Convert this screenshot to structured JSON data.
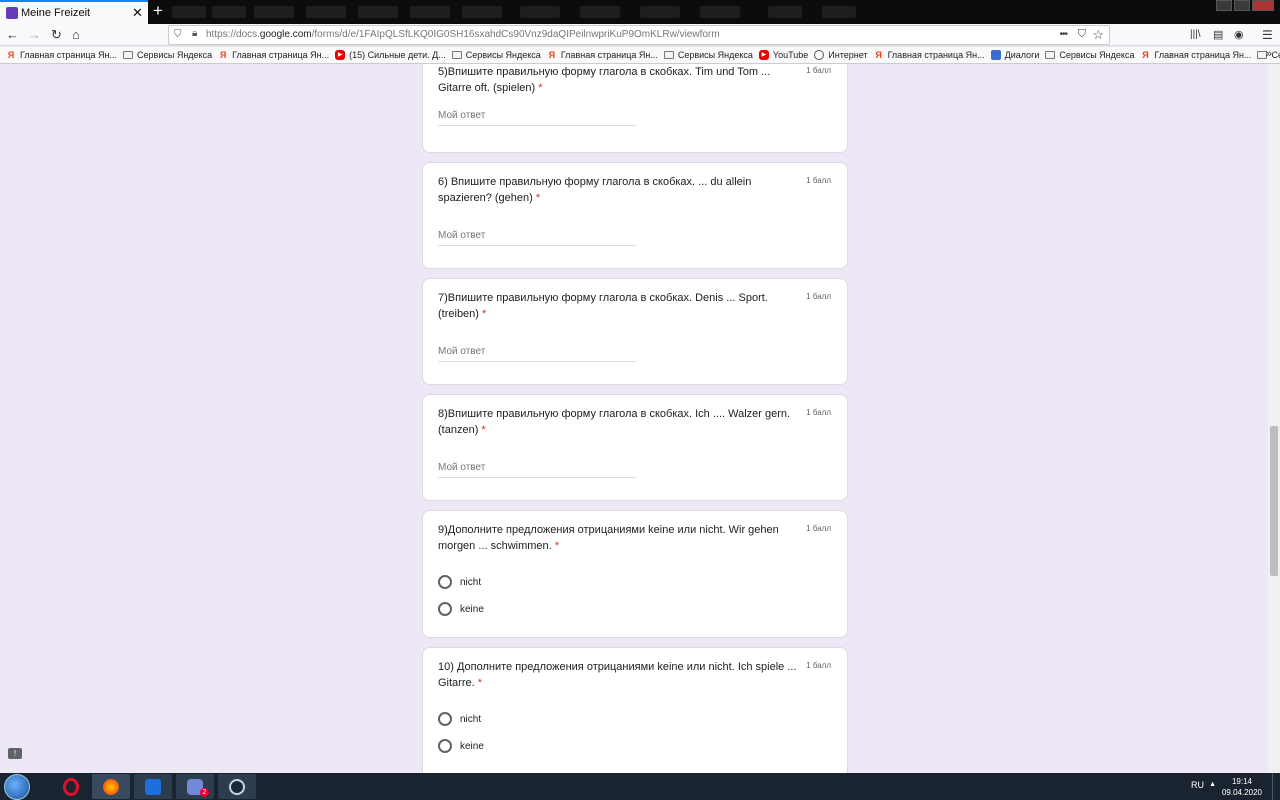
{
  "browser": {
    "tab_title": "Meine Freizeit",
    "tab_close": "✕",
    "new_tab": "+",
    "url_prefix": "https://docs.",
    "url_domain": "google.com",
    "url_rest": "/forms/d/e/1FAIpQLSfLKQ0IG0SH16sxahdCs90Vnz9daQIPeilnwpriKuP9OmKLRw/viewform",
    "nav": {
      "back": "←",
      "forward": "→",
      "reload": "↻",
      "home": "⌂",
      "more": "•••",
      "pocket": "⛉",
      "star": "☆",
      "library": "|||\\",
      "sidebar": "▤",
      "account": "◉",
      "menu": "☰"
    },
    "bookmarks": [
      {
        "label": "Главная страница Ян...",
        "icon": "yandex-icon"
      },
      {
        "label": "Сервисы Яндекса",
        "icon": "folder-icon"
      },
      {
        "label": "Главная страница Ян...",
        "icon": "yandex-icon"
      },
      {
        "label": "(15) Сильные дети. Д...",
        "icon": "youtube-icon"
      },
      {
        "label": "Сервисы Яндекса",
        "icon": "folder-icon"
      },
      {
        "label": "Главная страница Ян...",
        "icon": "yandex-icon"
      },
      {
        "label": "Сервисы Яндекса",
        "icon": "folder-icon"
      },
      {
        "label": "YouTube",
        "icon": "youtube-icon"
      },
      {
        "label": "Интернет",
        "icon": "globe-icon"
      },
      {
        "label": "Главная страница Ян...",
        "icon": "yandex-icon"
      },
      {
        "label": "Диалоги",
        "icon": "dialogs-icon"
      },
      {
        "label": "Сервисы Яндекса",
        "icon": "folder-icon"
      },
      {
        "label": "Главная страница Ян...",
        "icon": "yandex-icon"
      },
      {
        "label": "Сервисы Яндекса",
        "icon": "folder-icon"
      }
    ],
    "bookmarks_overflow": "»"
  },
  "form": {
    "required_mark": "*",
    "answer_placeholder": "Мой ответ",
    "questions": [
      {
        "text": "5)Впишите правильную форму глагола в скобках. Tim und Tom ... Gitarre oft. (spielen)",
        "points": "1 балл"
      },
      {
        "text": "6) Впишите правильную форму глагола в скобках. ... du allein spazieren? (gehen)",
        "points": "1 балл"
      },
      {
        "text": "7)Впишите правильную форму глагола в скобках. Denis ... Sport. (treiben)",
        "points": "1 балл"
      },
      {
        "text": "8)Впишите правильную форму глагола в скобках. Ich .... Walzer gern. (tanzen)",
        "points": "1 балл"
      },
      {
        "text": "9)Дополните предложения отрицаниями keine или nicht. Wir gehen morgen ... schwimmen.",
        "points": "1 балл",
        "options": [
          "nicht",
          "keine"
        ]
      },
      {
        "text": "10) Дополните предложения отрицаниями keine или nicht. Ich spiele ... Gitarre.",
        "points": "1 балл",
        "options": [
          "nicht",
          "keine"
        ]
      }
    ]
  },
  "taskbar": {
    "apps": [
      "opera-icon",
      "firefox-icon",
      "malwarebytes-icon",
      "discord-icon",
      "steam-icon"
    ],
    "discord_badge": "2",
    "language": "RU",
    "time": "19:14",
    "date": "09.04.2020"
  },
  "colors": {
    "form_bg": "#ede7f6",
    "required": "#d93025",
    "taskbar": "#1a2431",
    "accent": "#673ab7"
  }
}
